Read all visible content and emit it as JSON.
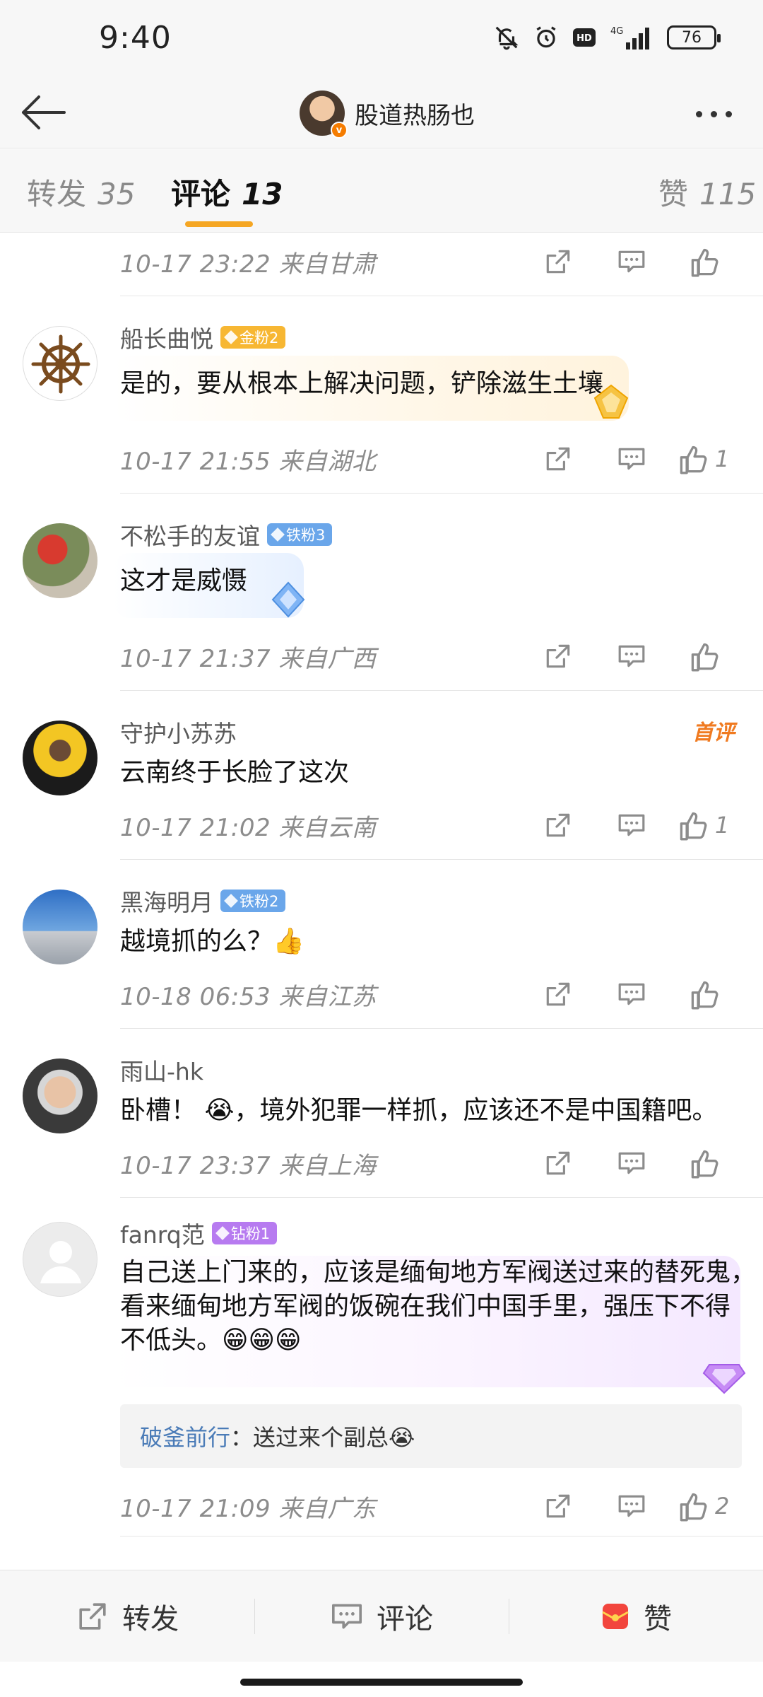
{
  "status_bar": {
    "time": "9:40",
    "battery": "76",
    "network": "4G",
    "hd": "HD"
  },
  "header": {
    "username": "股道热肠也"
  },
  "tabs": [
    {
      "label": "转发",
      "count": "35"
    },
    {
      "label": "评论",
      "count": "13"
    },
    {
      "label": "赞",
      "count": "115"
    }
  ],
  "top_meta": {
    "meta": "10-17  23:22  来自甘肃"
  },
  "comments": [
    {
      "user": "船长曲悦",
      "badge": "金粉2",
      "text": "是的，要从根本上解决问题，铲除滋生土壤",
      "meta": "10-17  21:55  来自湖北",
      "likes": "1"
    },
    {
      "user": "不松手的友谊",
      "badge": "铁粉3",
      "text": "这才是威慑",
      "meta": "10-17  21:37  来自广西",
      "likes": ""
    },
    {
      "user": "守护小苏苏",
      "badge": "",
      "featured": "首评",
      "text": "云南终于长脸了这次",
      "meta": "10-17  21:02  来自云南",
      "likes": "1"
    },
    {
      "user": "黑海明月",
      "badge": "铁粉2",
      "text": "越境抓的么？👍",
      "meta": "10-18  06:53  来自江苏",
      "likes": ""
    },
    {
      "user": "雨山-hk",
      "badge": "",
      "text": "卧槽！ 😭，境外犯罪一样抓，应该还不是中国籍吧。",
      "meta": "10-17  23:37  来自上海",
      "likes": ""
    },
    {
      "user": "fanrq范",
      "badge": "钻粉1",
      "text_lines": [
        "自己送上门来的，应该是缅甸地方军阀送过来的替死鬼，",
        "看来缅甸地方军阀的饭碗在我们中国手里，强压下不得",
        "不低头。😁😁😁"
      ],
      "reply": {
        "name": "破釜前行",
        "sep": "：",
        "text": "送过来个副总😭"
      },
      "meta": "10-17  21:09  来自广东",
      "likes": "2"
    }
  ],
  "bottom_bar": {
    "repost": "转发",
    "comment": "评论",
    "like": "赞"
  },
  "colors": {
    "accent": "#f5a623",
    "gold_badge": "#f7b733",
    "iron_badge": "#6aa6ea",
    "diamond_badge": "#b77bf0",
    "featured": "#f07a20",
    "reply_name": "#4a7bb7"
  }
}
